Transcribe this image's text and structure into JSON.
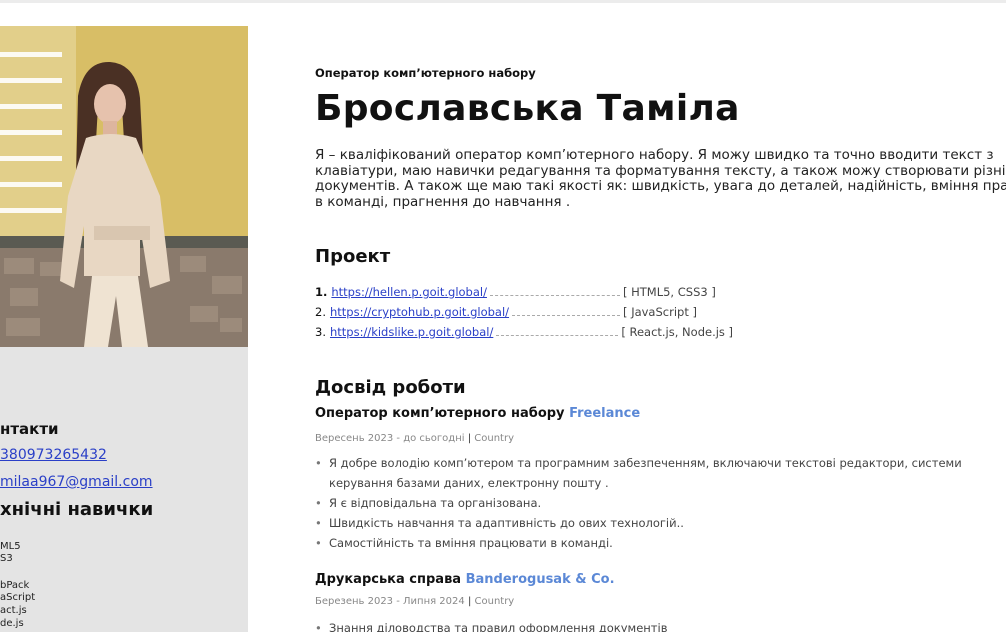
{
  "sidebar": {
    "contacts_title": "нтакти",
    "phone": "380973265432",
    "email": "milaa967@gmail.com",
    "skills_title": "хнічні навички",
    "skills": [
      "ML5",
      "S3",
      "bPack",
      "aScript",
      "act.js",
      "de.js"
    ]
  },
  "header": {
    "subtitle": "Оператор комп’ютерного набору",
    "name": "Брославська Таміла"
  },
  "about": [
    "Я – кваліфікований оператор комп’ютерного набору. Я можу швидко та точно вводити текст з",
    "клавіатури, маю навички редагування та форматування тексту, а також можу створювати різні типи",
    "документів. А також ще маю такі якості як: швидкість, увага до деталей, надійність, вміння працювати",
    "в команді, прагнення до навчання ."
  ],
  "projects": {
    "title": "Проект",
    "items": [
      {
        "num": "1.",
        "url": "https://hellen.p.goit.global/",
        "tech": "[ HTML5, CSS3 ]"
      },
      {
        "num": "2.",
        "url": "https://cryptohub.p.goit.global/",
        "tech": "[ JavaScript ]"
      },
      {
        "num": "3.",
        "url": "https://kidslike.p.goit.global/",
        "tech": "[ React.js, Node.js ]"
      }
    ]
  },
  "experience": {
    "title": "Досвід роботи",
    "jobs": [
      {
        "role": "Оператор комп’ютерного набору",
        "company": "Freelance",
        "dates": "Вересень 2023 - до сьогодні",
        "sep": "|",
        "location": "Country",
        "bullets": [
          "Я добре володію комп’ютером та програмним забезпеченням, включаючи текстові редактори, системи",
          "керування базами даних, електронну пошту .",
          "Я є відповідальна та організована.",
          "Швидкість навчання та адаптивність до овиx технологій..",
          "Самостійність та вміння працювати в команді."
        ]
      },
      {
        "role": "Друкарська справа",
        "company": "Banderogusak & Co.",
        "dates": "Березень 2023 - Липня 2024",
        "sep": "|",
        "location": "Country",
        "bullets": [
          "Знання діловодства та правил оформлення документів"
        ]
      }
    ]
  },
  "colors": {
    "link": "#2a3fc7",
    "company_accent": "#5b88d6",
    "sidebar_bg": "#e4e4e4"
  }
}
